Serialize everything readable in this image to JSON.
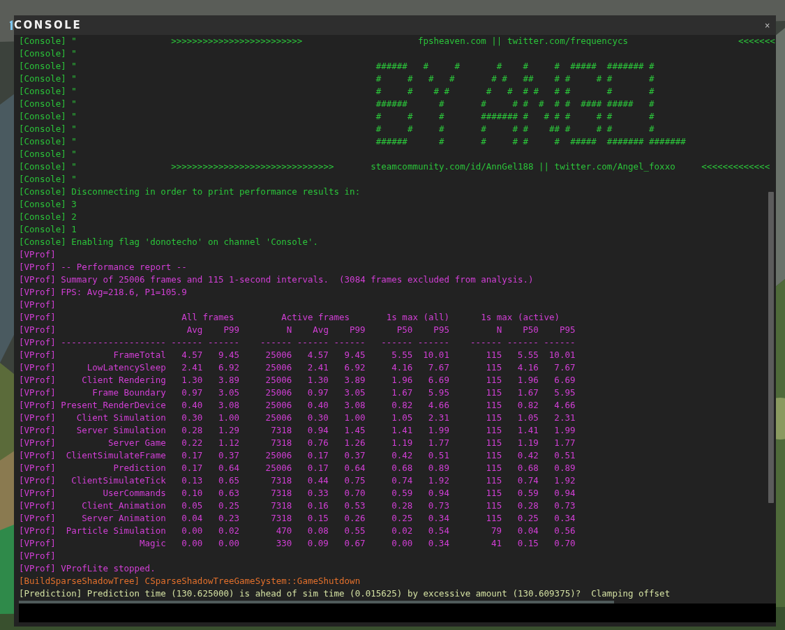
{
  "window": {
    "title": "CONSOLE",
    "close": "×"
  },
  "log": {
    "lines": [
      {
        "kind": "message",
        "color": "#2bc43a",
        "tag": "[Console]",
        "text": "\"                  >>>>>>>>>>>>>>>>>>>>>>>>>                      fpsheaven.com || twitter.com/frequencycs                     <<<<<<<"
      },
      {
        "kind": "message",
        "color": "#2bc43a",
        "tag": "[Console]",
        "text": "\""
      },
      {
        "kind": "art",
        "color": "#2bc43a",
        "tag": "[Console]",
        "text": "\"",
        "art": "######   #     #       #    #     #  #####  ####### #"
      },
      {
        "kind": "art",
        "color": "#2bc43a",
        "tag": "[Console]",
        "text": "\"",
        "art": "#     #   #   #       # #   ##    # #     # #       #"
      },
      {
        "kind": "art",
        "color": "#2bc43a",
        "tag": "[Console]",
        "text": "\"",
        "art": "#     #    # #       #   #  # #   # #       #       #"
      },
      {
        "kind": "art",
        "color": "#2bc43a",
        "tag": "[Console]",
        "text": "\"",
        "art": "######      #       #     # #  #  # #  #### #####   #"
      },
      {
        "kind": "art",
        "color": "#2bc43a",
        "tag": "[Console]",
        "text": "\"",
        "art": "#     #     #       ####### #   # # #     # #       #"
      },
      {
        "kind": "art",
        "color": "#2bc43a",
        "tag": "[Console]",
        "text": "\"",
        "art": "#     #     #       #     # #    ## #     # #       #"
      },
      {
        "kind": "art",
        "color": "#2bc43a",
        "tag": "[Console]",
        "text": "\"",
        "art": "######      #       #     # #     #  #####  ####### #######"
      },
      {
        "kind": "message",
        "color": "#2bc43a",
        "tag": "[Console]",
        "text": "\""
      },
      {
        "kind": "message",
        "color": "#2bc43a",
        "tag": "[Console]",
        "text": "\"                  >>>>>>>>>>>>>>>>>>>>>>>>>>>>>>>       steamcommunity.com/id/AnnGel188 || twitter.com/Angel_foxxo     <<<<<<<<<<<<<"
      },
      {
        "kind": "message",
        "color": "#2bc43a",
        "tag": "[Console]",
        "text": "\""
      },
      {
        "kind": "message",
        "color": "#2bc43a",
        "tag": "[Console]",
        "text": "Disconnecting in order to print performance results in:"
      },
      {
        "kind": "message",
        "color": "#2bc43a",
        "tag": "[Console]",
        "text": "3"
      },
      {
        "kind": "message",
        "color": "#2bc43a",
        "tag": "[Console]",
        "text": "2"
      },
      {
        "kind": "message",
        "color": "#2bc43a",
        "tag": "[Console]",
        "text": "1"
      },
      {
        "kind": "message",
        "color": "#2bc43a",
        "tag": "[Console]",
        "text": "Enabling flag 'donotecho' on channel 'Console'."
      },
      {
        "kind": "message",
        "color": "#d23fd6",
        "tag": "[VProf]"
      },
      {
        "kind": "message",
        "color": "#d23fd6",
        "tag": "[VProf]",
        "text": "-- Performance report --"
      },
      {
        "kind": "message",
        "color": "#d23fd6",
        "tag": "[VProf]",
        "text": "Summary of 25006 frames and 115 1-second intervals.  (3084 frames excluded from analysis.)"
      },
      {
        "kind": "message",
        "color": "#d23fd6",
        "tag": "[VProf]",
        "text": "FPS: Avg=218.6, P1=105.9"
      },
      {
        "kind": "message",
        "color": "#d23fd6",
        "tag": "[VProf]"
      },
      {
        "kind": "groups",
        "color": "#d23fd6",
        "tag": "[VProf]",
        "groups": [
          "All frames",
          "Active frames",
          "1s max (all)",
          "1s max (active)"
        ]
      },
      {
        "kind": "header",
        "color": "#d23fd6",
        "tag": "[VProf]",
        "columns": [
          "Avg",
          "P99",
          "N",
          "Avg",
          "P99",
          "P50",
          "P95",
          "N",
          "P50",
          "P95"
        ]
      },
      {
        "kind": "rule",
        "color": "#d23fd6",
        "tag": "[VProf]",
        "dashes": [
          "--------------------",
          "------",
          "------",
          "------",
          "------",
          "------",
          "------",
          "------",
          "------",
          "------",
          "------"
        ]
      },
      {
        "kind": "row",
        "color": "#d23fd6",
        "tag": "[VProf]",
        "name": "FrameTotal",
        "values": [
          "4.57",
          "9.45",
          "25006",
          "4.57",
          "9.45",
          "5.55",
          "10.01",
          "115",
          "5.55",
          "10.01"
        ]
      },
      {
        "kind": "row",
        "color": "#d23fd6",
        "tag": "[VProf]",
        "name": "LowLatencySleep",
        "values": [
          "2.41",
          "6.92",
          "25006",
          "2.41",
          "6.92",
          "4.16",
          "7.67",
          "115",
          "4.16",
          "7.67"
        ]
      },
      {
        "kind": "row",
        "color": "#d23fd6",
        "tag": "[VProf]",
        "name": "Client Rendering",
        "values": [
          "1.30",
          "3.89",
          "25006",
          "1.30",
          "3.89",
          "1.96",
          "6.69",
          "115",
          "1.96",
          "6.69"
        ]
      },
      {
        "kind": "row",
        "color": "#d23fd6",
        "tag": "[VProf]",
        "name": "Frame Boundary",
        "values": [
          "0.97",
          "3.05",
          "25006",
          "0.97",
          "3.05",
          "1.67",
          "5.95",
          "115",
          "1.67",
          "5.95"
        ]
      },
      {
        "kind": "row",
        "color": "#d23fd6",
        "tag": "[VProf]",
        "name": "Present_RenderDevice",
        "values": [
          "0.40",
          "3.08",
          "25006",
          "0.40",
          "3.08",
          "0.82",
          "4.66",
          "115",
          "0.82",
          "4.66"
        ]
      },
      {
        "kind": "row",
        "color": "#d23fd6",
        "tag": "[VProf]",
        "name": "Client Simulation",
        "values": [
          "0.30",
          "1.00",
          "25006",
          "0.30",
          "1.00",
          "1.05",
          "2.31",
          "115",
          "1.05",
          "2.31"
        ]
      },
      {
        "kind": "row",
        "color": "#d23fd6",
        "tag": "[VProf]",
        "name": "Server Simulation",
        "values": [
          "0.28",
          "1.29",
          "7318",
          "0.94",
          "1.45",
          "1.41",
          "1.99",
          "115",
          "1.41",
          "1.99"
        ]
      },
      {
        "kind": "row",
        "color": "#d23fd6",
        "tag": "[VProf]",
        "name": "Server Game",
        "values": [
          "0.22",
          "1.12",
          "7318",
          "0.76",
          "1.26",
          "1.19",
          "1.77",
          "115",
          "1.19",
          "1.77"
        ]
      },
      {
        "kind": "row",
        "color": "#d23fd6",
        "tag": "[VProf]",
        "name": "ClientSimulateFrame",
        "values": [
          "0.17",
          "0.37",
          "25006",
          "0.17",
          "0.37",
          "0.42",
          "0.51",
          "115",
          "0.42",
          "0.51"
        ]
      },
      {
        "kind": "row",
        "color": "#d23fd6",
        "tag": "[VProf]",
        "name": "Prediction",
        "values": [
          "0.17",
          "0.64",
          "25006",
          "0.17",
          "0.64",
          "0.68",
          "0.89",
          "115",
          "0.68",
          "0.89"
        ]
      },
      {
        "kind": "row",
        "color": "#d23fd6",
        "tag": "[VProf]",
        "name": "ClientSimulateTick",
        "values": [
          "0.13",
          "0.65",
          "7318",
          "0.44",
          "0.75",
          "0.74",
          "1.92",
          "115",
          "0.74",
          "1.92"
        ]
      },
      {
        "kind": "row",
        "color": "#d23fd6",
        "tag": "[VProf]",
        "name": "UserCommands",
        "values": [
          "0.10",
          "0.63",
          "7318",
          "0.33",
          "0.70",
          "0.59",
          "0.94",
          "115",
          "0.59",
          "0.94"
        ]
      },
      {
        "kind": "row",
        "color": "#d23fd6",
        "tag": "[VProf]",
        "name": "Client_Animation",
        "values": [
          "0.05",
          "0.25",
          "7318",
          "0.16",
          "0.53",
          "0.28",
          "0.73",
          "115",
          "0.28",
          "0.73"
        ]
      },
      {
        "kind": "row",
        "color": "#d23fd6",
        "tag": "[VProf]",
        "name": "Server Animation",
        "values": [
          "0.04",
          "0.23",
          "7318",
          "0.15",
          "0.26",
          "0.25",
          "0.34",
          "115",
          "0.25",
          "0.34"
        ]
      },
      {
        "kind": "row",
        "color": "#d23fd6",
        "tag": "[VProf]",
        "name": "Particle Simulation",
        "values": [
          "0.00",
          "0.02",
          "470",
          "0.08",
          "0.55",
          "0.02",
          "0.54",
          "79",
          "0.04",
          "0.56"
        ]
      },
      {
        "kind": "row",
        "color": "#d23fd6",
        "tag": "[VProf]",
        "name": "Magic",
        "values": [
          "0.00",
          "0.00",
          "330",
          "0.09",
          "0.67",
          "0.00",
          "0.34",
          "41",
          "0.15",
          "0.70"
        ]
      },
      {
        "kind": "message",
        "color": "#d23fd6",
        "tag": "[VProf]"
      },
      {
        "kind": "message",
        "color": "#d23fd6",
        "tag": "[VProf]",
        "text": "VProfLite stopped."
      },
      {
        "kind": "message",
        "color": "#e2702c",
        "tag": "[BuildSparseShadowTree]",
        "text": "CSparseShadowTreeGameSystem::GameShutdown"
      },
      {
        "kind": "message",
        "color": "#d3e0a2",
        "tag": "[Prediction]",
        "text": "Prediction time (130.625000) is ahead of sim time (0.015625) by excessive amount (130.609375)?  Clamping offset"
      }
    ]
  }
}
